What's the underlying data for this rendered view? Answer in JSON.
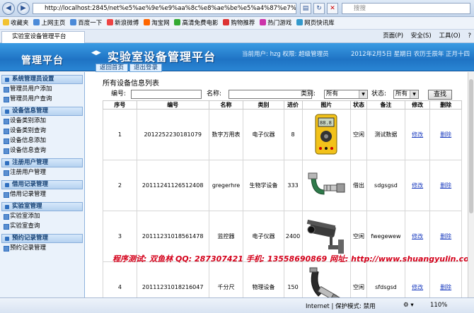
{
  "browser": {
    "url": "http://localhost:2845/net%e5%ae%9e%e9%aa%8c%e8%ae%be%e5%a4%87%e7%ae%a1%e7%",
    "search_placeholder": "搜搜",
    "favorites_label": "收藏夹",
    "favorites": [
      "上网主页",
      "百度一下",
      "新浪微博",
      "淘宝网",
      "高清免费电影",
      "购物推荐",
      "热门游戏",
      "网页快讯库"
    ],
    "tab_title": "实验室设备管理平台",
    "commands": [
      "页面(P)",
      "安全(S)",
      "工具(O)",
      "?"
    ],
    "status_zone": "Internet | 保护模式: 禁用",
    "zoom": "110%"
  },
  "header": {
    "logo": "管理平台",
    "title": "实验室设备管理平台",
    "user_info": "当前用户: hzg 权限: 超级管理员",
    "date_info": "2012年2月5日 星期日 农历壬辰年 正月十四",
    "back_button": "返回首页",
    "logout_button": "退出登录"
  },
  "sidebar": {
    "sections": [
      {
        "title": "系统管理员设置",
        "items": [
          "管理员用户添加",
          "管理员用户查询"
        ]
      },
      {
        "title": "设备信息管理",
        "items": [
          "设备类别添加",
          "设备类别查询",
          "设备信息添加",
          "设备信息查询"
        ]
      },
      {
        "title": "注册用户管理",
        "items": [
          "注册用户管理"
        ]
      },
      {
        "title": "借用记录管理",
        "items": [
          "借用记录管理"
        ]
      },
      {
        "title": "实验室管理",
        "items": [
          "实验室添加",
          "实验室查询"
        ]
      },
      {
        "title": "预约记录管理",
        "items": [
          "预约记录管理"
        ]
      }
    ]
  },
  "main": {
    "list_title": "所有设备信息列表",
    "filter": {
      "code_label": "编号:",
      "name_label": "名称:",
      "category_label": "类别:",
      "category_value": "所有",
      "status_label": "状态:",
      "status_value": "所有",
      "find_button": "查找"
    },
    "columns": [
      "序号",
      "编号",
      "名称",
      "类别",
      "进价",
      "图片",
      "状态",
      "备注",
      "修改",
      "删除"
    ],
    "rows": [
      {
        "no": "1",
        "code": "2012252230181079",
        "name": "数字万用表",
        "category": "电子仪器",
        "price": "8",
        "image": "multimeter",
        "status": "空闲",
        "note": "测试数据",
        "edit": "修改",
        "del": "删除"
      },
      {
        "no": "2",
        "code": "20111241126512408",
        "name": "gregerhre",
        "category": "生物学设备",
        "price": "333",
        "image": "micrometer",
        "status": "借出",
        "note": "sdgsgsd",
        "edit": "修改",
        "del": "删除"
      },
      {
        "no": "3",
        "code": "20111231018561478",
        "name": "监控器",
        "category": "电子仪器",
        "price": "2400",
        "image": "camera",
        "status": "空闲",
        "note": "fwegewew",
        "edit": "修改",
        "del": "删除"
      },
      {
        "no": "4",
        "code": "20111231018216047",
        "name": "千分尺",
        "category": "物理设备",
        "price": "150",
        "image": "caliper",
        "status": "空闲",
        "note": "sfdsgsd",
        "edit": "修改",
        "del": "删除"
      }
    ],
    "watermark": "程序测试: 双鱼林    QQ: 287307421    手机: 13558690869    网址: http://www.shuangyulin.com"
  },
  "colors": {
    "header_blue": "#1f73c4",
    "link": "#2040c0",
    "watermark_red": "#d4001a"
  }
}
